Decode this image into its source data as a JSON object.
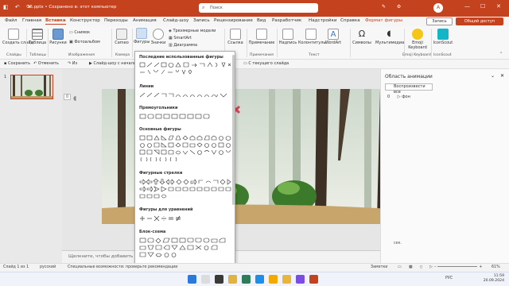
{
  "titlebar": {
    "doc_title": "26.pptx • Сохранено в: этот компьютер",
    "search_placeholder": "Поиск",
    "avatar": "A"
  },
  "tabs": [
    "Файл",
    "Главная",
    "Вставка",
    "Конструктор",
    "Переходы",
    "Анимация",
    "Слайд-шоу",
    "Запись",
    "Рецензирование",
    "Вид",
    "Разработчик",
    "Надстройки",
    "Справка",
    "Формат фигуры"
  ],
  "active_tab": "Вставка",
  "record_label": "Запись",
  "share_label": "Общий доступ",
  "ribbon": {
    "new_slide": "Создать слайд",
    "table": "Таблица",
    "images": "Рисунки",
    "screenshot": "Снимок",
    "photo_album": "Фотоальбом",
    "cameo": "Cameo",
    "shapes": "Фигуры",
    "icons": "Значки",
    "models_3d": "Трехмерные модели",
    "smartart": "SmartArt",
    "chart": "Диаграмма",
    "link": "Ссылка",
    "comment": "Примечание",
    "textbox": "Надпись",
    "header_footer": "Колонтитулы",
    "wordart": "WordArt",
    "symbols": "Символы",
    "media": "Мультимедиа",
    "emoji_keyboard": "Emoji Keyboard",
    "iconscout": "IconScout",
    "groups": {
      "slides": "Слайды",
      "tables": "Таблицы",
      "images": "Изображения",
      "camera": "Камера",
      "comments": "Примечания",
      "text": "Текст",
      "emoji": "Emoji Keyboard",
      "iconscout": "IconScout"
    }
  },
  "quick_access": {
    "save": "Сохранить",
    "undo": "Отменить",
    "redo": "Из",
    "slideshow_start": "Слайд-шоу с начала",
    "from_current": "С текущего слайда"
  },
  "shapes_gallery": {
    "recent": "Последние использованные фигуры",
    "lines": "Линии",
    "rectangles": "Прямоугольники",
    "basic": "Основные фигуры",
    "arrows": "Фигурные стрелки",
    "equations": "Фигуры для уравнений",
    "flowchart": "Блок-схема"
  },
  "slide_panel": {
    "slide_number": "1"
  },
  "notes_placeholder": "Щелкните, чтобы добавить заметки",
  "animation_pane": {
    "title": "Область анимации",
    "play_all": "Воспроизвести все",
    "item_index": "0",
    "item_label": "фон",
    "time_label": "сек."
  },
  "status": {
    "slide_of": "Слайд 1 из 1",
    "language": "русский",
    "accessibility": "Специальные возможности: проверьте рекомендации",
    "notes": "Заметки",
    "zoom": "61%"
  },
  "taskbar": {
    "lang": "РУС",
    "time": "11:59",
    "date": "20.09.2024"
  },
  "colors": {
    "accent": "#c4421e"
  }
}
